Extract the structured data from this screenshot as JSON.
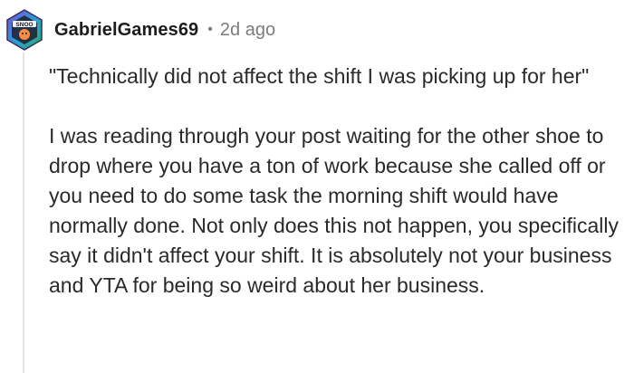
{
  "comment": {
    "author": "GabrielGames69",
    "separator": "•",
    "time_ago": "2d ago",
    "avatar_icon": "snoo-avatar-hexagon-icon",
    "avatar_badge_text": "SNOO",
    "paragraphs": [
      "\"Technically did not affect the shift I was picking up for her\"",
      "I was reading through your post waiting for the other shoe to drop where you have a ton of work because she called off or you need to do some task the morning shift would have normally done. Not only does this not happen, you specifically say it didn't affect your shift. It is absolutely not your business and YTA for being so weird about her business."
    ]
  },
  "colors": {
    "username": "#1c1c1c",
    "meta": "#7c7c7c",
    "body_text": "#2a2a2a",
    "thread_line": "#e3e3e3"
  }
}
